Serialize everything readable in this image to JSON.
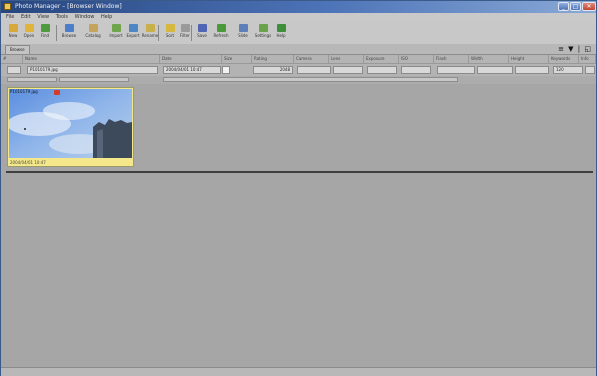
{
  "window": {
    "title": "Photo Manager – [Browser Window]",
    "controls": [
      "_",
      "□",
      "✕"
    ]
  },
  "menu": [
    "File",
    "Edit",
    "View",
    "Tools",
    "Window",
    "Help"
  ],
  "toolbar": [
    {
      "label": "New",
      "color": "#d9a83a"
    },
    {
      "label": "Open",
      "color": "#e0b43c"
    },
    {
      "label": "Find",
      "color": "#4f9a3f"
    },
    {
      "label": "Browse",
      "color": "#4c7fc9"
    },
    {
      "label": "Catalog",
      "color": "#c4a35a"
    },
    {
      "label": "Import",
      "color": "#6fa64c"
    },
    {
      "label": "Export",
      "color": "#4f86c6"
    },
    {
      "label": "Rename",
      "color": "#c9b04a"
    },
    {
      "label": "Sort",
      "color": "#d6b83e"
    },
    {
      "label": "Filter",
      "color": "#9a9a9a"
    },
    {
      "label": "Save",
      "color": "#5066b4"
    },
    {
      "label": "Refresh",
      "color": "#4a9a3c"
    },
    {
      "label": "Slide",
      "color": "#5f7fb9"
    },
    {
      "label": "Settings",
      "color": "#6aa24a"
    },
    {
      "label": "Help",
      "color": "#3f8f3a"
    }
  ],
  "subbar": {
    "tab": "Browse",
    "view_icons": "≡ ▼ | ◱"
  },
  "columns": [
    "#",
    "Name",
    "Date",
    "Size",
    "Rating",
    "Camera",
    "Lens",
    "Exposure",
    "ISO",
    "Flash",
    "Width",
    "Height",
    "Keywords",
    "Info"
  ],
  "filter": {
    "name": "P1010179.jpg",
    "date": "2004/04/01 10:47",
    "size": "2048",
    "extra": "120"
  },
  "thumbnail": {
    "label": "P1010179.jpg",
    "caption": "2004/04/01 10:47"
  }
}
